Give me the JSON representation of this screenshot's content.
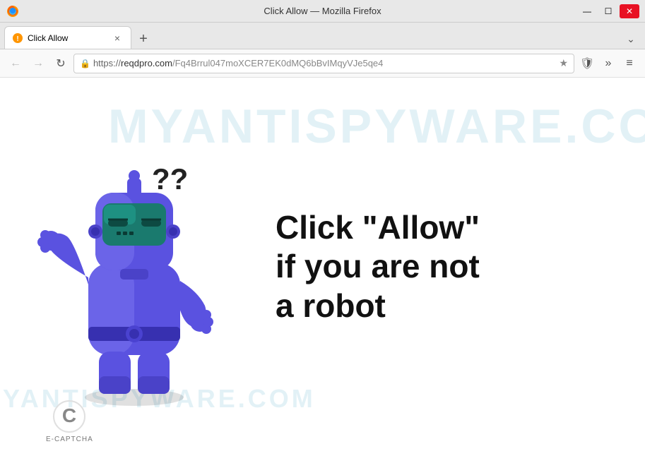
{
  "titlebar": {
    "title": "Click Allow — Mozilla Firefox",
    "min_label": "—",
    "max_label": "☐",
    "close_label": "✕"
  },
  "tab": {
    "label": "Click Allow",
    "close_label": "×"
  },
  "tab_new_label": "+",
  "tab_overflow_label": "⌄",
  "navbar": {
    "back_label": "←",
    "forward_label": "→",
    "reload_label": "↻",
    "url": "https://reqdpro.com/Fq4Brrul047moXCER7EK0dMQ6bBvIMqyVJe5qe4",
    "url_domain": "reqdpro.com",
    "url_path": "/Fq4Brrul047moXCER7EK0dMQ6bBvIMqyVJe5qe4",
    "star_label": "★",
    "shield_label": "🛡",
    "more_label": "»",
    "menu_label": "≡"
  },
  "page": {
    "main_line1": "Click \"Allow\"",
    "main_line2": "if you are not",
    "main_line3": "a robot"
  },
  "ecaptcha": {
    "label": "E-CAPTCHA"
  },
  "watermark": {
    "text": "MYANTISPYWARE.COM"
  },
  "colors": {
    "robot_body": "#5a52e0",
    "robot_dark": "#3d35c0",
    "robot_visor": "#1a7a6e",
    "robot_eye": "#222"
  }
}
